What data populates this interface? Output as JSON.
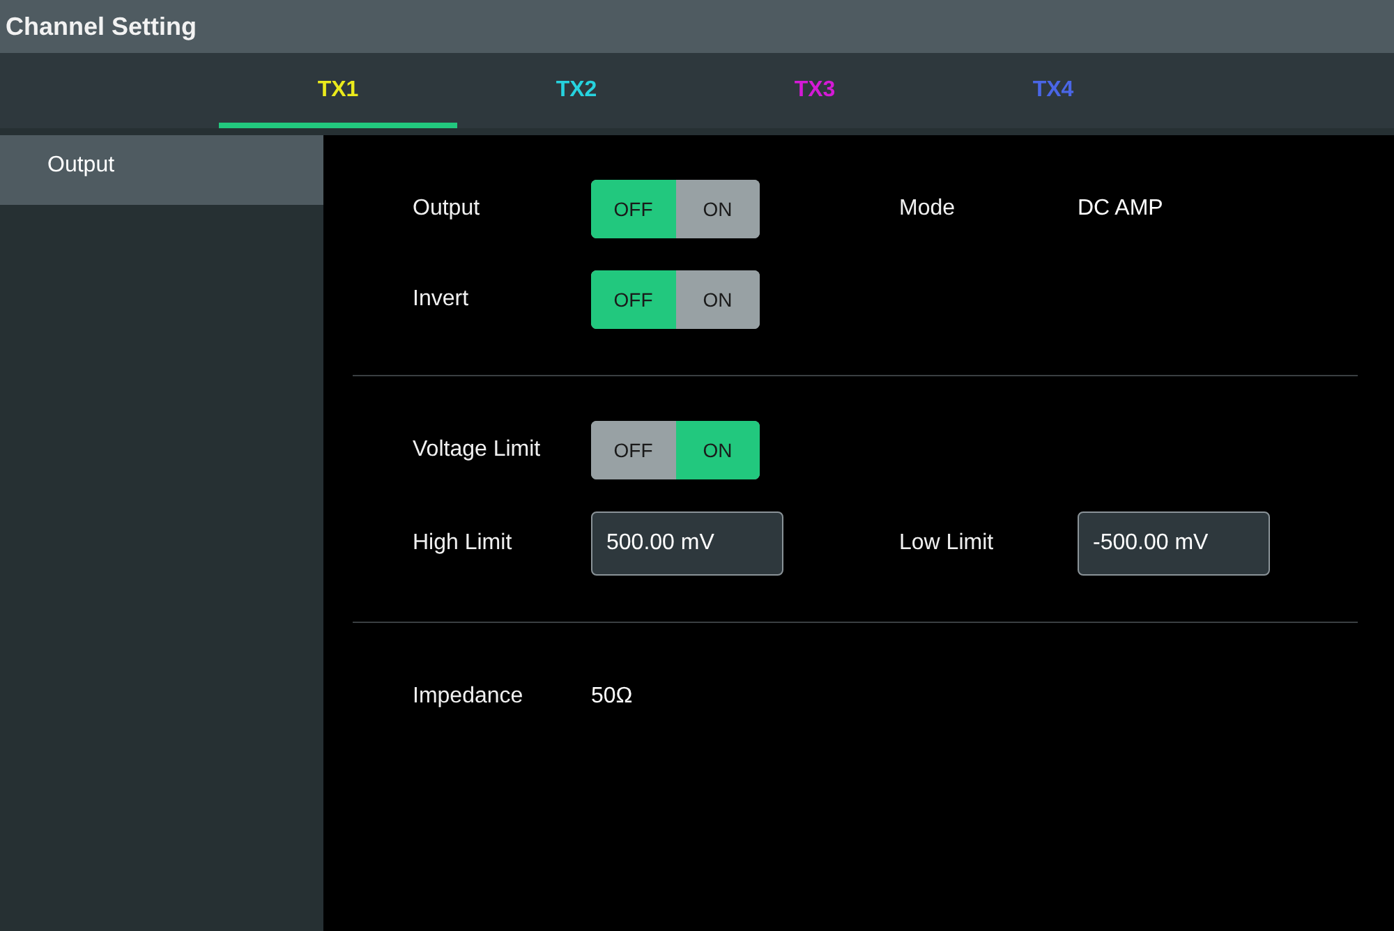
{
  "window": {
    "title": "Channel Setting"
  },
  "tabs": [
    {
      "label": "TX1",
      "color": "#eaea1c",
      "selected": true
    },
    {
      "label": "TX2",
      "color": "#26d2de",
      "selected": false
    },
    {
      "label": "TX3",
      "color": "#d41ad6",
      "selected": false
    },
    {
      "label": "TX4",
      "color": "#4a66e6",
      "selected": false
    }
  ],
  "sidebar": {
    "items": [
      {
        "label": "Output",
        "selected": true
      }
    ]
  },
  "sections": [
    {
      "rows": [
        [
          {
            "kind": "toggle",
            "label": "Output",
            "options": [
              {
                "label": "OFF",
                "selected": true
              },
              {
                "label": "ON",
                "selected": false
              }
            ]
          },
          {
            "kind": "text",
            "label": "Mode",
            "value": "DC AMP"
          }
        ],
        [
          {
            "kind": "toggle",
            "label": "Invert",
            "options": [
              {
                "label": "OFF",
                "selected": true
              },
              {
                "label": "ON",
                "selected": false
              }
            ]
          }
        ]
      ]
    },
    {
      "rows": [
        [
          {
            "kind": "toggle",
            "label": "Voltage Limit",
            "options": [
              {
                "label": "OFF",
                "selected": false
              },
              {
                "label": "ON",
                "selected": true
              }
            ]
          }
        ],
        [
          {
            "kind": "field",
            "label": "High Limit",
            "value": "500.00 mV"
          },
          {
            "kind": "field",
            "label": "Low Limit",
            "value": "-500.00 mV"
          }
        ]
      ]
    },
    {
      "rows": [
        [
          {
            "kind": "text",
            "label": "Impedance",
            "value": "50Ω"
          }
        ]
      ]
    }
  ]
}
